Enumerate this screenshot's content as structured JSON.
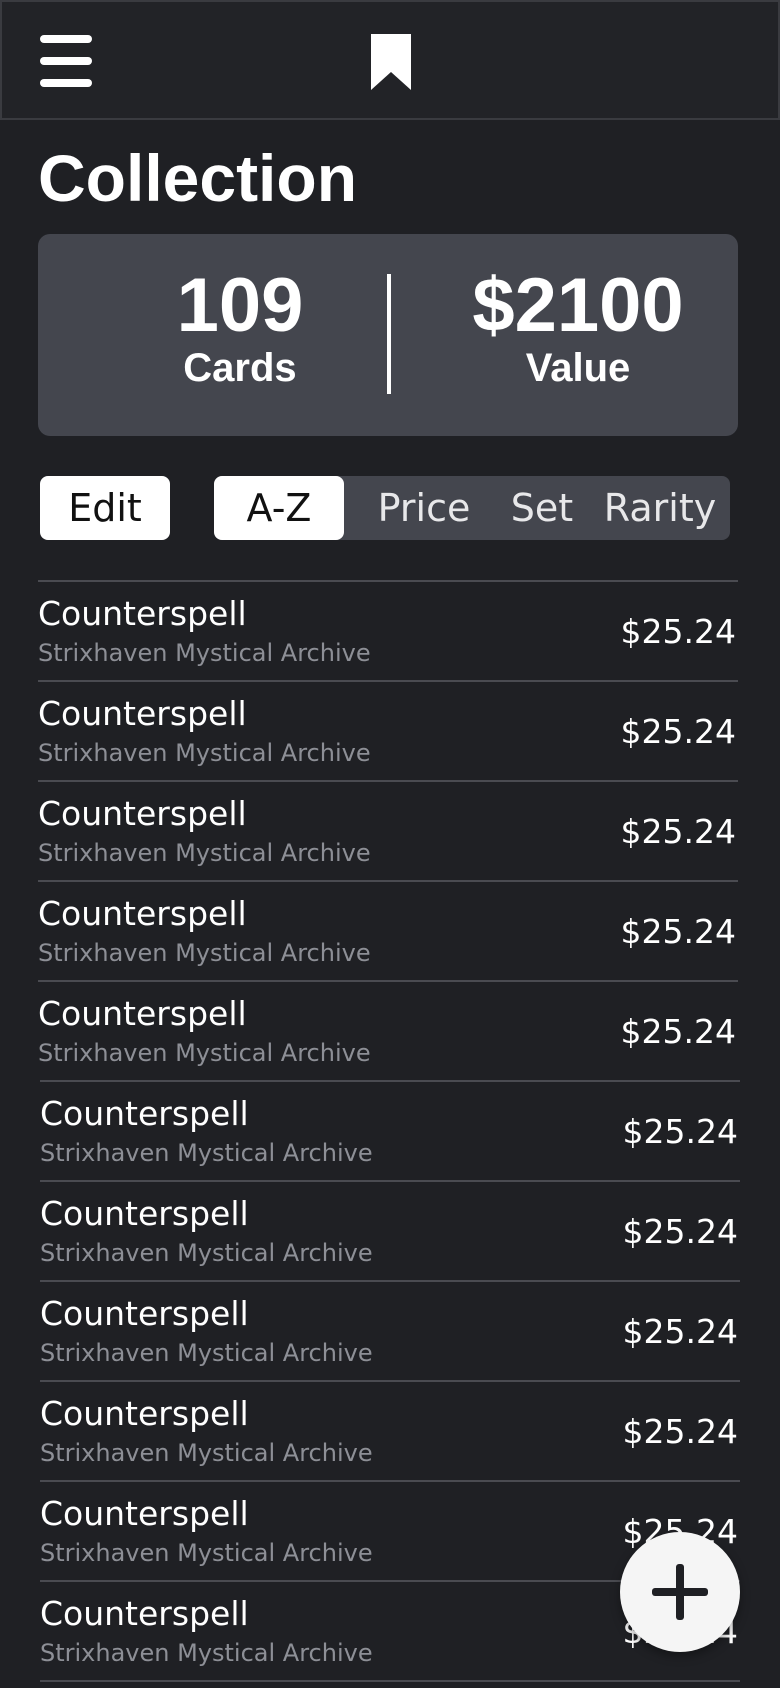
{
  "header": {
    "menu_icon": "hamburger-menu-icon",
    "bookmark_icon": "bookmark-icon"
  },
  "page": {
    "title": "Collection"
  },
  "stats": {
    "cards_count": "109",
    "cards_label": "Cards",
    "value_amount": "$2100",
    "value_label": "Value"
  },
  "toolbar": {
    "edit_label": "Edit",
    "sort_options": [
      "A-Z",
      "Price",
      "Set",
      "Rarity"
    ],
    "active_sort": "A-Z"
  },
  "cards": [
    {
      "name": "Counterspell",
      "set": "Strixhaven Mystical Archive",
      "price": "$25.24"
    },
    {
      "name": "Counterspell",
      "set": "Strixhaven Mystical Archive",
      "price": "$25.24"
    },
    {
      "name": "Counterspell",
      "set": "Strixhaven Mystical Archive",
      "price": "$25.24"
    },
    {
      "name": "Counterspell",
      "set": "Strixhaven Mystical Archive",
      "price": "$25.24"
    },
    {
      "name": "Counterspell",
      "set": "Strixhaven Mystical Archive",
      "price": "$25.24"
    },
    {
      "name": "Counterspell",
      "set": "Strixhaven Mystical Archive",
      "price": "$25.24"
    },
    {
      "name": "Counterspell",
      "set": "Strixhaven Mystical Archive",
      "price": "$25.24"
    },
    {
      "name": "Counterspell",
      "set": "Strixhaven Mystical Archive",
      "price": "$25.24"
    },
    {
      "name": "Counterspell",
      "set": "Strixhaven Mystical Archive",
      "price": "$25.24"
    },
    {
      "name": "Counterspell",
      "set": "Strixhaven Mystical Archive",
      "price": "$25.24"
    },
    {
      "name": "Counterspell",
      "set": "Strixhaven Mystical Archive",
      "price": "$25.24"
    }
  ],
  "fab": {
    "icon": "plus-icon"
  },
  "colors": {
    "background": "#1f2024",
    "panel": "#44464e",
    "muted_text": "#8d8f96",
    "active": "#ffffff"
  }
}
